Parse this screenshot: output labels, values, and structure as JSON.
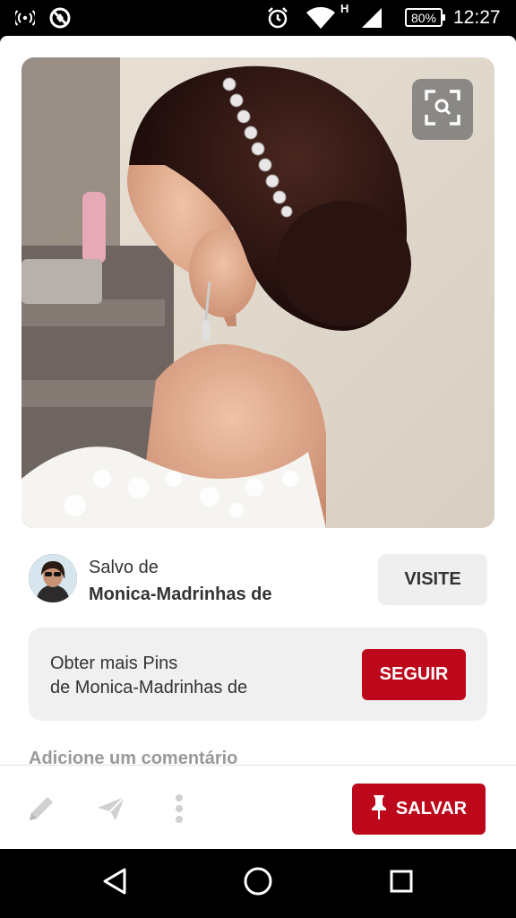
{
  "status_bar": {
    "battery": "80%",
    "time": "12:27",
    "network_type": "H",
    "icons": [
      "wireless-signal-icon",
      "no-location-icon",
      "alarm-icon",
      "wifi-icon",
      "cellular-signal-icon",
      "battery-icon"
    ]
  },
  "pin": {
    "image_icon": "visual-search-icon"
  },
  "saved_from": {
    "label": "Salvo de",
    "board": "Monica-Madrinhas de",
    "visit_label": "VISITE"
  },
  "follow": {
    "line1": "Obter mais Pins",
    "line2": "de Monica-Madrinhas de",
    "button_label": "SEGUIR"
  },
  "comment": {
    "placeholder": "Adicione um comentário"
  },
  "actions": {
    "icons": [
      "edit-icon",
      "send-icon",
      "more-icon"
    ],
    "save_label": "SALVAR",
    "save_icon": "pin-icon",
    "brand_red": "#bd081c"
  },
  "nav": {
    "icons": [
      "back-icon",
      "home-icon",
      "recents-icon"
    ]
  }
}
